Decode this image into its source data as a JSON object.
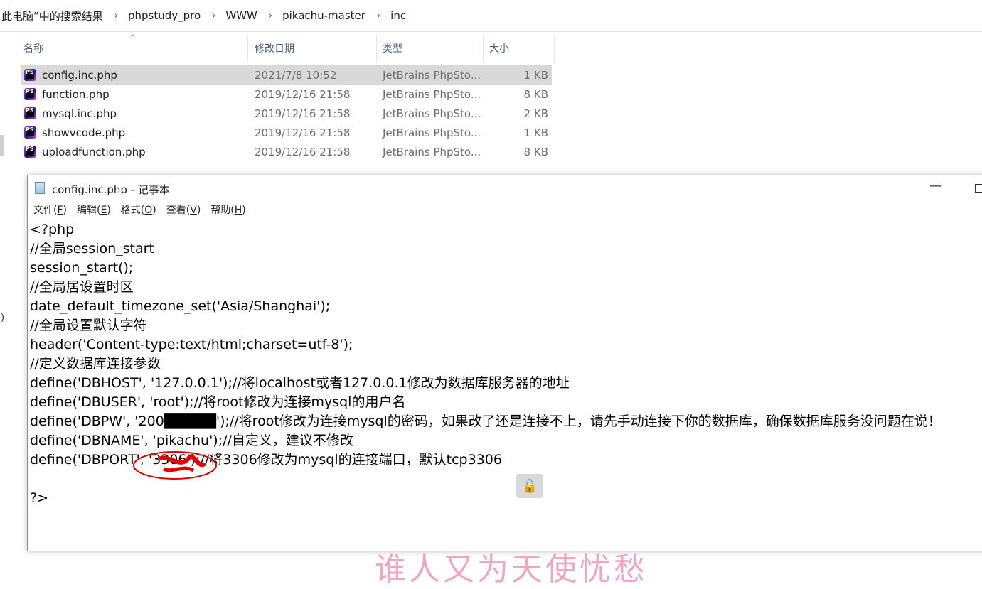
{
  "breadcrumb": {
    "items": [
      "此电脑”中的搜索结果",
      "phpstudy_pro",
      "WWW",
      "pikachu-master",
      "inc"
    ],
    "separator": "›"
  },
  "columns": {
    "name": "名称",
    "date": "修改日期",
    "type": "类型",
    "size": "大小"
  },
  "files": [
    {
      "name": "config.inc.php",
      "date": "2021/7/8 10:52",
      "type": "JetBrains PhpSto...",
      "size": "1 KB",
      "selected": true
    },
    {
      "name": "function.php",
      "date": "2019/12/16 21:58",
      "type": "JetBrains PhpSto...",
      "size": "8 KB"
    },
    {
      "name": "mysql.inc.php",
      "date": "2019/12/16 21:58",
      "type": "JetBrains PhpSto...",
      "size": "2 KB"
    },
    {
      "name": "showvcode.php",
      "date": "2019/12/16 21:58",
      "type": "JetBrains PhpSto...",
      "size": "1 KB"
    },
    {
      "name": "uploadfunction.php",
      "date": "2019/12/16 21:58",
      "type": "JetBrains PhpSto...",
      "size": "8 KB"
    }
  ],
  "file_icon": "phpstorm-file-icon",
  "file_icon_text": "PS",
  "left_edge_char": ")",
  "notepad": {
    "title": "config.inc.php - 记事本",
    "minimize": "—",
    "menus": [
      {
        "label": "文件",
        "key": "F"
      },
      {
        "label": "编辑",
        "key": "E"
      },
      {
        "label": "格式",
        "key": "O"
      },
      {
        "label": "查看",
        "key": "V"
      },
      {
        "label": "帮助",
        "key": "H"
      }
    ],
    "code_lines": [
      "<?php",
      "//全局session_start",
      "session_start();",
      "//全局居设置时区",
      "date_default_timezone_set('Asia/Shanghai');",
      "//全局设置默认字符",
      "header('Content-type:text/html;charset=utf-8');",
      "//定义数据库连接参数",
      "define('DBHOST', '127.0.0.1');//将localhost或者127.0.0.1修改为数据库服务器的地址",
      "define('DBUSER', 'root');//将root修改为连接mysql的用户名",
      "define('DBPW', '200█████');//将root修改为连接mysql的密码，如果改了还是连接不上，请先手动连接下你的数据库，确保数据库服务没问题在说！",
      "define('DBNAME', 'pikachu');//自定义，建议不修改",
      "define('DBPORT', '3306');//将3306修改为mysql的连接端口，默认tcp3306",
      "",
      "?>"
    ],
    "lock_glyph": "🔓"
  },
  "watermark": "谁人又为天使忧愁",
  "colors": {
    "selected_row": "#d9d9d9",
    "header_text": "#4c607a",
    "scribble": "#e00000",
    "watermark": "#f2a6c0"
  }
}
